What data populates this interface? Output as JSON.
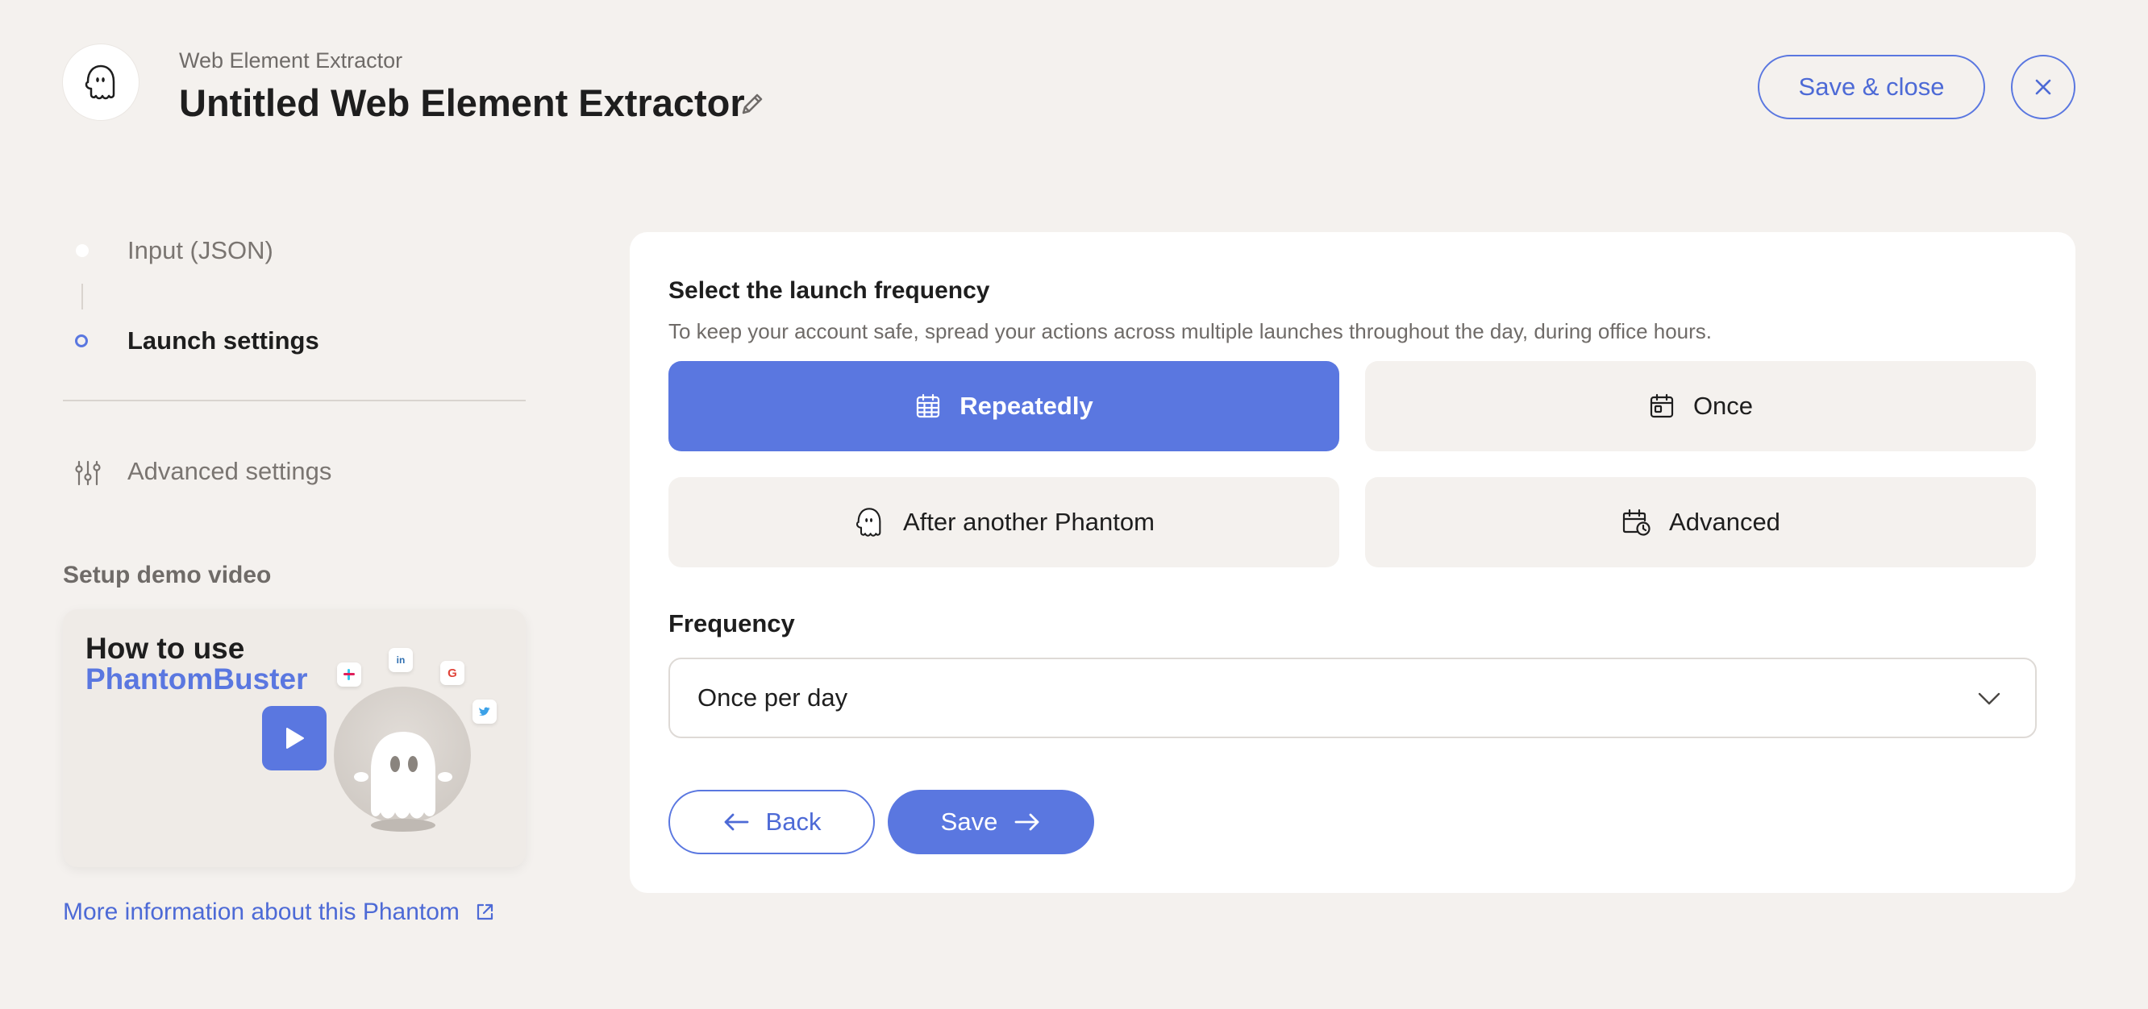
{
  "header": {
    "subtitle": "Web Element Extractor",
    "title": "Untitled Web Element Extractor",
    "save_close_label": "Save & close"
  },
  "steps": {
    "input_label": "Input (JSON)",
    "launch_label": "Launch settings",
    "advanced_label": "Advanced settings"
  },
  "demo": {
    "title": "Setup demo video",
    "video_line1": "How to use",
    "video_line2": "PhantomBuster"
  },
  "more_link": "More information about this Phantom",
  "launch": {
    "title": "Select the launch frequency",
    "description": "To keep your account safe, spread your actions across multiple launches throughout the day, during office hours.",
    "options": [
      {
        "label": "Repeatedly",
        "icon": "calendar-grid-icon",
        "selected": true
      },
      {
        "label": "Once",
        "icon": "calendar-day-icon",
        "selected": false
      },
      {
        "label": "After another Phantom",
        "icon": "ghost-icon",
        "selected": false
      },
      {
        "label": "Advanced",
        "icon": "calendar-clock-icon",
        "selected": false
      }
    ],
    "frequency_label": "Frequency",
    "frequency_value": "Once per day",
    "back_label": "Back",
    "save_label": "Save"
  },
  "colors": {
    "accent": "#5a77e0",
    "background": "#f4f1ee",
    "card": "#ffffff"
  }
}
